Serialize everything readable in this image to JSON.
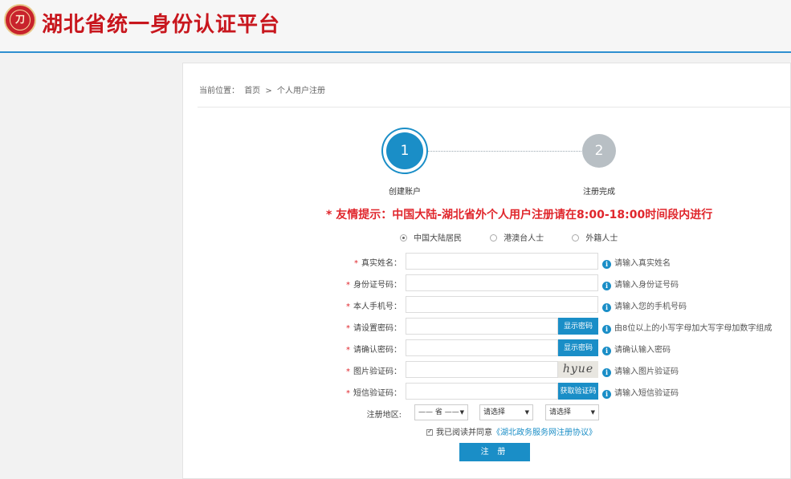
{
  "header": {
    "logo_glyph": "刀",
    "site_title": "湖北省统一身份认证平台"
  },
  "breadcrumb": {
    "prefix": "当前位置：",
    "home": "首页",
    "separator": ">",
    "current": "个人用户注册"
  },
  "steps": [
    {
      "number": "1",
      "label": "创建账户",
      "active": true
    },
    {
      "number": "2",
      "label": "注册完成",
      "active": false
    }
  ],
  "notice": "* 友情提示：中国大陆-湖北省外个人用户注册请在8:00-18:00时间段内进行",
  "residency": {
    "options": [
      "中国大陆居民",
      "港澳台人士",
      "外籍人士"
    ],
    "selected": "中国大陆居民"
  },
  "form": {
    "real_name": {
      "label": "真实姓名：",
      "value": "",
      "hint": "请输入真实姓名"
    },
    "id_number": {
      "label": "身份证号码：",
      "value": "",
      "hint": "请输入身份证号码"
    },
    "phone": {
      "label": "本人手机号：",
      "value": "",
      "hint": "请输入您的手机号码"
    },
    "password": {
      "label": "请设置密码：",
      "value": "",
      "button": "显示密码",
      "hint": "由8位以上的小写字母加大写字母加数字组成"
    },
    "confirm_password": {
      "label": "请确认密码：",
      "value": "",
      "button": "显示密码",
      "hint": "请确认输入密码"
    },
    "image_captcha": {
      "label": "图片验证码：",
      "value": "",
      "captcha_text": "hyue",
      "hint": "请输入图片验证码"
    },
    "sms_code": {
      "label": "短信验证码：",
      "value": "",
      "button": "获取验证码",
      "hint": "请输入短信验证码"
    },
    "required_mark": "*",
    "info_icon_glyph": "i"
  },
  "region": {
    "label": "注册地区:",
    "province": "—— 省 ——",
    "city": "请选择",
    "district": "请选择",
    "arrow": "▼"
  },
  "agreement": {
    "text": "我已阅读并同意",
    "link": "《湖北政务服务网注册协议》",
    "checked": true
  },
  "submit_label": "注 册",
  "colors": {
    "accent": "#1a8ec7",
    "warning": "#e0262c",
    "title_red": "#c8161d"
  }
}
